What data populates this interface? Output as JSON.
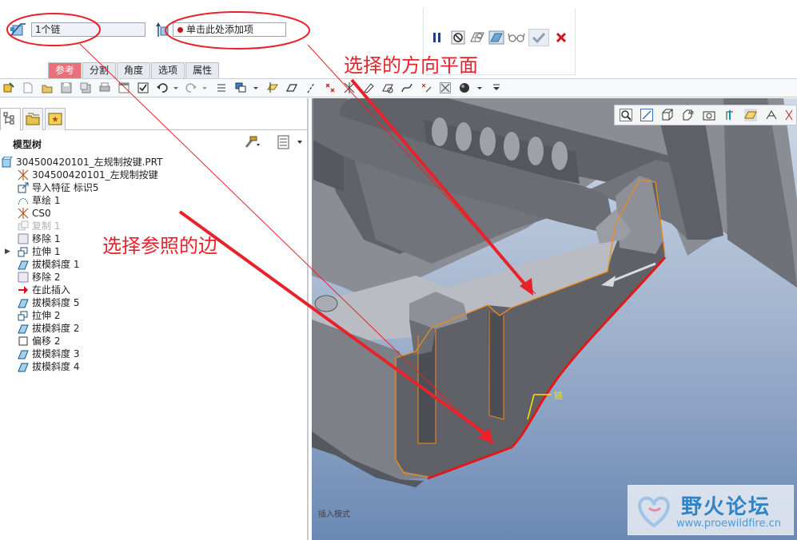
{
  "dashboard": {
    "chain_field_value": "1个链",
    "add_item_placeholder": "单击此处添加项",
    "tabs": [
      {
        "label": "参考",
        "active": true
      },
      {
        "label": "分割",
        "active": false
      },
      {
        "label": "角度",
        "active": false
      },
      {
        "label": "选项",
        "active": false
      },
      {
        "label": "属性",
        "active": false
      }
    ],
    "controls": [
      "pause-icon",
      "no-preview-icon",
      "wireframe-preview-icon",
      "shaded-preview-icon",
      "glasses-icon",
      "accept-icon",
      "cancel-icon"
    ]
  },
  "model_tree": {
    "title": "模型树",
    "items": [
      {
        "label": "304500420101_左规制按键.PRT",
        "icon": "part-icon",
        "indent": 0,
        "dim": false
      },
      {
        "label": "304500420101_左规制按键",
        "icon": "csys-icon",
        "indent": 1,
        "dim": false
      },
      {
        "label": "导入特征 标识5",
        "icon": "import-feature-icon",
        "indent": 1,
        "dim": false
      },
      {
        "label": "草绘 1",
        "icon": "sketch-icon",
        "indent": 1,
        "dim": false
      },
      {
        "label": "CS0",
        "icon": "csys-icon",
        "indent": 1,
        "dim": false
      },
      {
        "label": "复制 1",
        "icon": "copy-icon",
        "indent": 1,
        "dim": true
      },
      {
        "label": "移除 1",
        "icon": "remove-icon",
        "indent": 1,
        "dim": false
      },
      {
        "label": "拉伸 1",
        "icon": "extrude-icon",
        "indent": 1,
        "dim": false,
        "expandable": true
      },
      {
        "label": "拔模斜度 1",
        "icon": "draft-icon",
        "indent": 1,
        "dim": false
      },
      {
        "label": "移除 2",
        "icon": "remove-icon",
        "indent": 1,
        "dim": false
      },
      {
        "label": "在此插入",
        "icon": "insert-here-icon",
        "indent": 1,
        "dim": false
      },
      {
        "label": "拔模斜度 5",
        "icon": "draft-icon",
        "indent": 1,
        "dim": false
      },
      {
        "label": "拉伸 2",
        "icon": "extrude-icon",
        "indent": 1,
        "dim": false
      },
      {
        "label": "拔模斜度 2",
        "icon": "draft-icon",
        "indent": 1,
        "dim": false
      },
      {
        "label": "偏移 2",
        "icon": "offset-icon",
        "indent": 1,
        "dim": false
      },
      {
        "label": "拔模斜度 3",
        "icon": "draft-icon",
        "indent": 1,
        "dim": false
      },
      {
        "label": "拔模斜度 4",
        "icon": "draft-icon",
        "indent": 1,
        "dim": false
      }
    ]
  },
  "viewport": {
    "status_text": "插入模式",
    "chain_label": "链"
  },
  "annotations": {
    "direction_plane": "选择的方向平面",
    "reference_edge": "选择参照的边"
  },
  "watermark": {
    "name": "野火论坛",
    "url": "www.proewildfire.cn"
  },
  "colors": {
    "annotation_red": "#e8222b",
    "tab_active": "#e8707a",
    "model_gray": "#5f6167",
    "highlight_orange": "#f08a1c"
  }
}
